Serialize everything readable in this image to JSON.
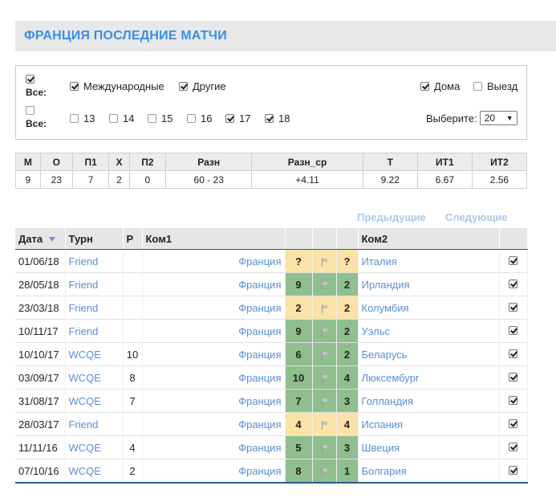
{
  "header": {
    "title": "ФРАНЦИЯ ПОСЛЕДНИЕ МАТЧИ"
  },
  "filters": {
    "all_label": "Все:",
    "tournament_all_checked": true,
    "tournaments": [
      {
        "label": "Международные",
        "checked": true
      },
      {
        "label": "Другие",
        "checked": true
      }
    ],
    "home": {
      "label": "Дома",
      "checked": true
    },
    "away": {
      "label": "Выезд",
      "checked": false
    },
    "years_all_checked": false,
    "years": [
      {
        "label": "13",
        "checked": false
      },
      {
        "label": "14",
        "checked": false
      },
      {
        "label": "15",
        "checked": false
      },
      {
        "label": "16",
        "checked": false
      },
      {
        "label": "17",
        "checked": true
      },
      {
        "label": "18",
        "checked": true
      }
    ],
    "select_label": "Выберите:",
    "select_value": "20"
  },
  "stats": {
    "headers": [
      "М",
      "О",
      "П1",
      "Х",
      "П2",
      "Разн",
      "Разн_ср",
      "Т",
      "ИТ1",
      "ИТ2"
    ],
    "values": [
      "9",
      "23",
      "7",
      "2",
      "0",
      "60 - 23",
      "+4.11",
      "9.22",
      "6.67",
      "2.56"
    ]
  },
  "pager": {
    "prev": "Предыдущие",
    "next": "Следующие"
  },
  "matches_table": {
    "headers": {
      "date": "Дата",
      "tournament": "Турн",
      "round": "Р",
      "team1": "Ком1",
      "team2": "Ком2"
    },
    "rows": [
      {
        "date": "01/06/18",
        "tournament": "Friend",
        "round": "",
        "team1": "Франция",
        "s1": "?",
        "s2": "?",
        "result": "draw",
        "team2": "Италия",
        "checked": true
      },
      {
        "date": "28/05/18",
        "tournament": "Friend",
        "round": "",
        "team1": "Франция",
        "s1": "9",
        "s2": "2",
        "result": "win",
        "team2": "Ирландия",
        "checked": true
      },
      {
        "date": "23/03/18",
        "tournament": "Friend",
        "round": "",
        "team1": "Франция",
        "s1": "2",
        "s2": "2",
        "result": "draw",
        "team2": "Колумбия",
        "checked": true
      },
      {
        "date": "10/11/17",
        "tournament": "Friend",
        "round": "",
        "team1": "Франция",
        "s1": "9",
        "s2": "2",
        "result": "win",
        "team2": "Уэльс",
        "checked": true
      },
      {
        "date": "10/10/17",
        "tournament": "WCQE",
        "round": "10",
        "team1": "Франция",
        "s1": "6",
        "s2": "2",
        "result": "win",
        "team2": "Беларусь",
        "checked": true
      },
      {
        "date": "03/09/17",
        "tournament": "WCQE",
        "round": "8",
        "team1": "Франция",
        "s1": "10",
        "s2": "4",
        "result": "win",
        "team2": "Люксембург",
        "checked": true
      },
      {
        "date": "31/08/17",
        "tournament": "WCQE",
        "round": "7",
        "team1": "Франция",
        "s1": "7",
        "s2": "3",
        "result": "win",
        "team2": "Голландия",
        "checked": true
      },
      {
        "date": "28/03/17",
        "tournament": "Friend",
        "round": "",
        "team1": "Франция",
        "s1": "4",
        "s2": "4",
        "result": "draw",
        "team2": "Испания",
        "checked": true
      },
      {
        "date": "11/11/16",
        "tournament": "WCQE",
        "round": "4",
        "team1": "Франция",
        "s1": "5",
        "s2": "3",
        "result": "win",
        "team2": "Швеция",
        "checked": true
      },
      {
        "date": "07/10/16",
        "tournament": "WCQE",
        "round": "2",
        "team1": "Франция",
        "s1": "8",
        "s2": "1",
        "result": "win",
        "team2": "Болгария",
        "checked": true
      }
    ]
  },
  "colors": {
    "accent": "#3a8ee6",
    "link": "#5b8fd0",
    "win": "#8fbe8f",
    "draw": "#fbe2a6",
    "pager": "#a9c8ec"
  },
  "icons": {
    "score_marker": "flag-icon",
    "sort": "sort-desc-icon"
  }
}
